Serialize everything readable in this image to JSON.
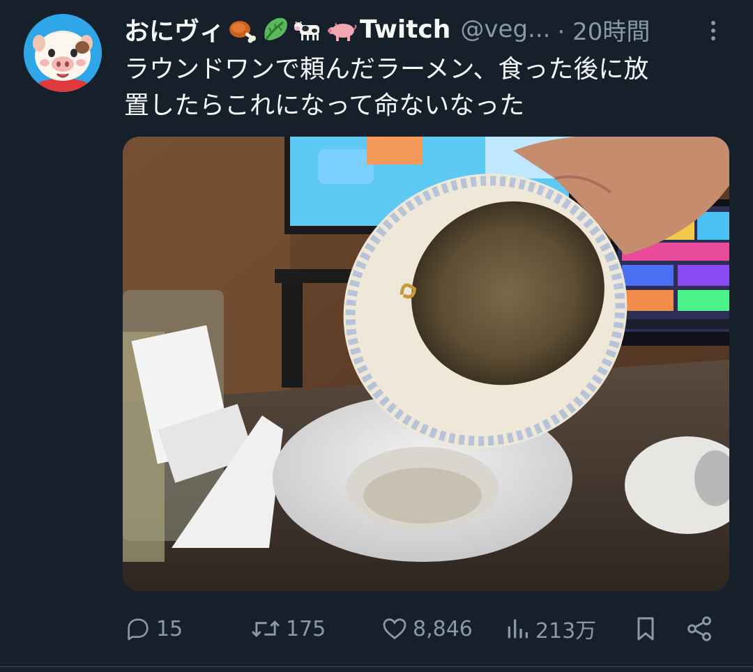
{
  "tweet": {
    "author": {
      "display_name": "おにヴィ",
      "name_emojis": [
        "meat-on-bone-emoji",
        "leafy-green-emoji",
        "cow-emoji",
        "pig-emoji"
      ],
      "name_suffix": "Twitch",
      "handle": "@veg...",
      "avatar": "cartoon-pig-avatar"
    },
    "time": "· 20時間",
    "text_line1": "ラウンドワンで頼んだラーメン、食った後に放",
    "text_line2": "置したらこれになって命ないなった",
    "media": {
      "description_icon": "photo"
    },
    "actions": {
      "reply_count": "15",
      "retweet_count": "175",
      "like_count": "8,846",
      "views_count": "213万"
    }
  },
  "colors": {
    "background": "#15202b",
    "text_primary": "#f7f9f9",
    "text_secondary": "#8b98a5",
    "avatar_ring": "#2fa6e8"
  },
  "icons": {
    "reply": "reply-icon",
    "retweet": "retweet-icon",
    "like": "heart-icon",
    "views": "bar-chart-icon",
    "bookmark": "bookmark-icon",
    "share": "share-icon",
    "more": "more-vertical-icon"
  }
}
